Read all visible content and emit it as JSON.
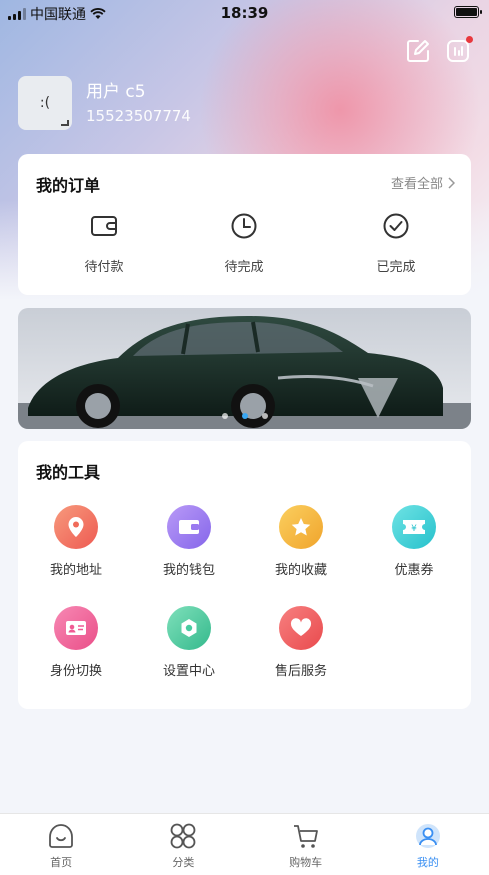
{
  "status_bar": {
    "carrier": "中国联通",
    "time": "18:39"
  },
  "profile": {
    "avatar_text": ":(",
    "username": "用户 c5",
    "phone": "15523507774"
  },
  "orders": {
    "title": "我的订单",
    "view_all": "查看全部",
    "items": [
      {
        "label": "待付款",
        "icon": "wallet-icon"
      },
      {
        "label": "待完成",
        "icon": "clock-icon"
      },
      {
        "label": "已完成",
        "icon": "check-circle-icon"
      }
    ]
  },
  "banner": {
    "slides": 3,
    "active_slide": 1
  },
  "tools": {
    "title": "我的工具",
    "items": [
      {
        "label": "我的地址",
        "icon": "location-pin-icon",
        "color": "#f06b5a"
      },
      {
        "label": "我的钱包",
        "icon": "wallet-icon",
        "color": "#9a7af0"
      },
      {
        "label": "我的收藏",
        "icon": "star-icon",
        "color": "#f3b53c"
      },
      {
        "label": "优惠券",
        "icon": "coupon-icon",
        "color": "#3fd0d6"
      },
      {
        "label": "身份切换",
        "icon": "id-card-icon",
        "color": "#f05a93"
      },
      {
        "label": "设置中心",
        "icon": "settings-icon",
        "color": "#48cba0"
      },
      {
        "label": "售后服务",
        "icon": "heart-icon",
        "color": "#f0585a"
      }
    ]
  },
  "tabbar": {
    "active": "我的",
    "items": [
      {
        "label": "首页",
        "icon": "home-icon"
      },
      {
        "label": "分类",
        "icon": "category-icon"
      },
      {
        "label": "购物车",
        "icon": "cart-icon"
      },
      {
        "label": "我的",
        "icon": "profile-icon"
      }
    ]
  },
  "colors": {
    "accent": "#3a8ff2"
  }
}
